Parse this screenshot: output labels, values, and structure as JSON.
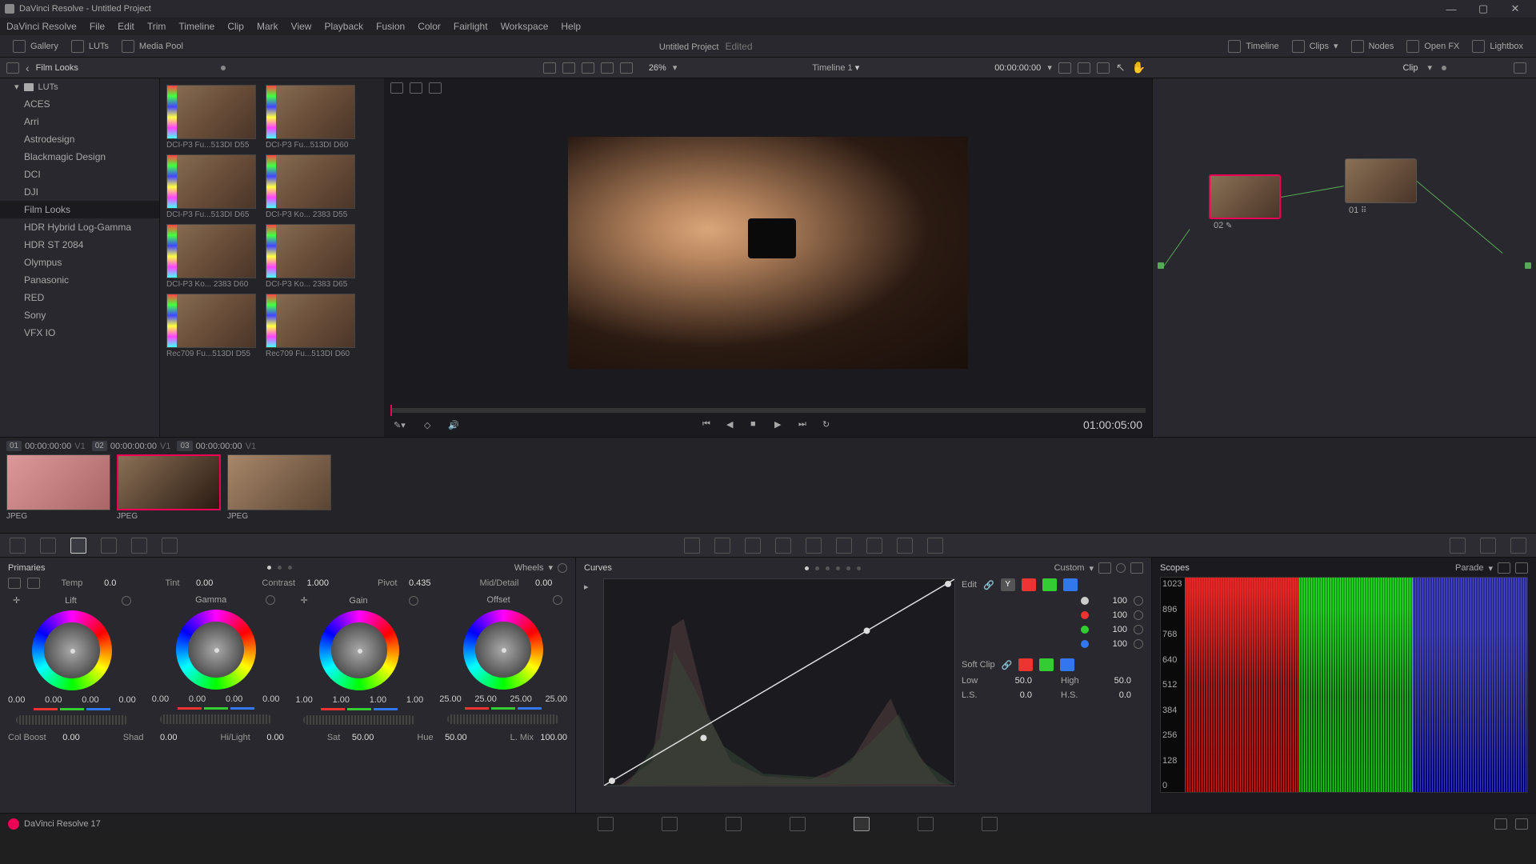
{
  "window": {
    "title": "DaVinci Resolve - Untitled Project"
  },
  "menu": [
    "DaVinci Resolve",
    "File",
    "Edit",
    "Trim",
    "Timeline",
    "Clip",
    "Mark",
    "View",
    "Playback",
    "Fusion",
    "Color",
    "Fairlight",
    "Workspace",
    "Help"
  ],
  "toolbar": {
    "gallery": "Gallery",
    "luts": "LUTs",
    "mediapool": "Media Pool",
    "project": "Untitled Project",
    "edited": "Edited",
    "timeline": "Timeline",
    "clips": "Clips",
    "nodes": "Nodes",
    "openfx": "Open FX",
    "lightbox": "Lightbox"
  },
  "subbar": {
    "browser": "Film Looks",
    "zoom": "26%",
    "timeline": "Timeline 1",
    "timecode": "00:00:00:00",
    "clip": "Clip"
  },
  "lut_tree": {
    "root": "LUTs",
    "items": [
      "ACES",
      "Arri",
      "Astrodesign",
      "Blackmagic Design",
      "DCI",
      "DJI",
      "Film Looks",
      "HDR Hybrid Log-Gamma",
      "HDR ST 2084",
      "Olympus",
      "Panasonic",
      "RED",
      "Sony",
      "VFX IO"
    ],
    "selected": "Film Looks"
  },
  "luts": [
    {
      "name": "DCI-P3 Fu...513DI D55"
    },
    {
      "name": "DCI-P3 Fu...513DI D60"
    },
    {
      "name": "DCI-P3 Fu...513DI D65"
    },
    {
      "name": "DCI-P3 Ko... 2383 D55"
    },
    {
      "name": "DCI-P3 Ko... 2383 D60"
    },
    {
      "name": "DCI-P3 Ko... 2383 D65"
    },
    {
      "name": "Rec709 Fu...513DI D55"
    },
    {
      "name": "Rec709 Fu...513DI D60"
    }
  ],
  "viewer": {
    "endtc": "01:00:05:00"
  },
  "clips": [
    {
      "num": "01",
      "tc": "00:00:00:00",
      "trk": "V1",
      "type": "JPEG"
    },
    {
      "num": "02",
      "tc": "00:00:00:00",
      "trk": "V1",
      "type": "JPEG"
    },
    {
      "num": "03",
      "tc": "00:00:00:00",
      "trk": "V1",
      "type": "JPEG"
    }
  ],
  "nodes": [
    {
      "id": "02"
    },
    {
      "id": "01"
    }
  ],
  "primaries": {
    "title": "Primaries",
    "mode": "Wheels",
    "adjust1": [
      {
        "lbl": "Temp",
        "val": "0.0"
      },
      {
        "lbl": "Tint",
        "val": "0.00"
      },
      {
        "lbl": "Contrast",
        "val": "1.000"
      },
      {
        "lbl": "Pivot",
        "val": "0.435"
      },
      {
        "lbl": "Mid/Detail",
        "val": "0.00"
      }
    ],
    "wheels": [
      {
        "name": "Lift",
        "vals": [
          "0.00",
          "0.00",
          "0.00",
          "0.00"
        ]
      },
      {
        "name": "Gamma",
        "vals": [
          "0.00",
          "0.00",
          "0.00",
          "0.00"
        ]
      },
      {
        "name": "Gain",
        "vals": [
          "1.00",
          "1.00",
          "1.00",
          "1.00"
        ]
      },
      {
        "name": "Offset",
        "vals": [
          "25.00",
          "25.00",
          "25.00",
          "25.00"
        ]
      }
    ],
    "adjust2": [
      {
        "lbl": "Col Boost",
        "val": "0.00"
      },
      {
        "lbl": "Shad",
        "val": "0.00"
      },
      {
        "lbl": "Hi/Light",
        "val": "0.00"
      },
      {
        "lbl": "Sat",
        "val": "50.00"
      },
      {
        "lbl": "Hue",
        "val": "50.00"
      },
      {
        "lbl": "L. Mix",
        "val": "100.00"
      }
    ]
  },
  "curves": {
    "title": "Curves",
    "mode": "Custom",
    "edit": "Edit",
    "channels": [
      {
        "c": "#ccc",
        "val": "100"
      },
      {
        "c": "#e33",
        "val": "100"
      },
      {
        "c": "#3c3",
        "val": "100"
      },
      {
        "c": "#37e",
        "val": "100"
      }
    ],
    "softclip": "Soft Clip",
    "low": {
      "lbl": "Low",
      "val": "50.0"
    },
    "high": {
      "lbl": "High",
      "val": "50.0"
    },
    "ls": {
      "lbl": "L.S.",
      "val": "0.0"
    },
    "hs": {
      "lbl": "H.S.",
      "val": "0.0"
    },
    "ybtn": "Y"
  },
  "scopes": {
    "title": "Scopes",
    "mode": "Parade",
    "scale": [
      "1023",
      "896",
      "768",
      "640",
      "512",
      "384",
      "256",
      "128",
      "0"
    ]
  },
  "footer": {
    "brand": "DaVinci Resolve 17"
  }
}
